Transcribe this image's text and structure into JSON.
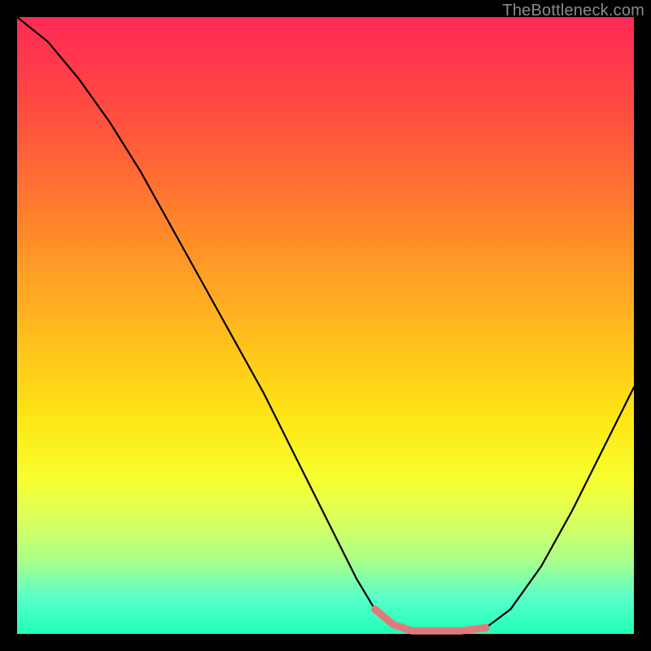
{
  "watermark": "TheBottleneck.com",
  "chart_data": {
    "type": "line",
    "title": "",
    "xlabel": "",
    "ylabel": "",
    "xlim": [
      0,
      1
    ],
    "ylim": [
      0,
      1
    ],
    "x": [
      0.0,
      0.05,
      0.1,
      0.15,
      0.2,
      0.25,
      0.3,
      0.35,
      0.4,
      0.45,
      0.5,
      0.55,
      0.58,
      0.61,
      0.64,
      0.68,
      0.72,
      0.76,
      0.8,
      0.85,
      0.9,
      0.95,
      1.0
    ],
    "values": [
      1.0,
      0.96,
      0.9,
      0.83,
      0.75,
      0.66,
      0.57,
      0.48,
      0.39,
      0.29,
      0.19,
      0.09,
      0.04,
      0.015,
      0.005,
      0.005,
      0.005,
      0.01,
      0.04,
      0.11,
      0.2,
      0.3,
      0.4
    ],
    "accent_segment": {
      "x": [
        0.58,
        0.61,
        0.64,
        0.68,
        0.72,
        0.76
      ],
      "values": [
        0.04,
        0.015,
        0.005,
        0.005,
        0.005,
        0.01
      ]
    },
    "gradient_stops": [
      {
        "pos": 0.0,
        "color": "#ff2a55"
      },
      {
        "pos": 0.5,
        "color": "#ffe615"
      },
      {
        "pos": 1.0,
        "color": "#1fffb8"
      }
    ],
    "colors": {
      "curve": "#000000",
      "accent": "#e07a7a",
      "background_frame": "#000000"
    }
  }
}
